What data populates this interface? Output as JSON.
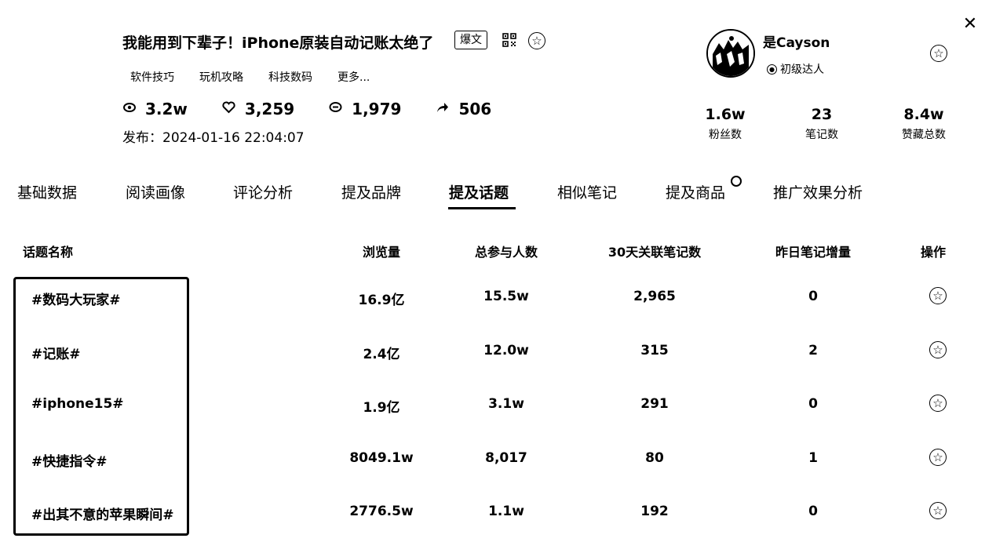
{
  "post": {
    "title": "我能用到下辈子！iPhone原装自动记账太绝了",
    "badge": "爆文",
    "tags": [
      "软件技巧",
      "玩机攻略",
      "科技数码",
      "更多..."
    ],
    "stats": {
      "views": "3.2w",
      "likes": "3,259",
      "comments": "1,979",
      "shares": "506"
    },
    "publish_label": "发布：",
    "publish_time": "2024-01-16 22:04:07"
  },
  "author": {
    "name": "是Cayson",
    "level": "初级达人",
    "metrics": [
      {
        "value": "1.6w",
        "label": "粉丝数"
      },
      {
        "value": "23",
        "label": "笔记数"
      },
      {
        "value": "8.4w",
        "label": "赞藏总数"
      }
    ]
  },
  "tabs": [
    "基础数据",
    "阅读画像",
    "评论分析",
    "提及品牌",
    "提及话题",
    "相似笔记",
    "提及商品",
    "推广效果分析"
  ],
  "active_tab": "提及话题",
  "table": {
    "headers": [
      "话题名称",
      "浏览量",
      "总参与人数",
      "30天关联笔记数",
      "昨日笔记增量",
      "操作"
    ],
    "rows": [
      {
        "topic": "#数码大玩家#",
        "views": "16.9亿",
        "participants": "15.5w",
        "notes30": "2,965",
        "yesterday": "0"
      },
      {
        "topic": "#记账#",
        "views": "2.4亿",
        "participants": "12.0w",
        "notes30": "315",
        "yesterday": "2"
      },
      {
        "topic": "#iphone15#",
        "views": "1.9亿",
        "participants": "3.1w",
        "notes30": "291",
        "yesterday": "0"
      },
      {
        "topic": "#快捷指令#",
        "views": "8049.1w",
        "participants": "8,017",
        "notes30": "80",
        "yesterday": "1"
      },
      {
        "topic": "#出其不意的苹果瞬间#",
        "views": "2776.5w",
        "participants": "1.1w",
        "notes30": "192",
        "yesterday": "0"
      }
    ]
  },
  "icons": {
    "close": "close-icon",
    "qr": "qr-code-icon",
    "star": "star-icon",
    "views": "eye-icon",
    "likes": "heart-icon",
    "comments": "comment-icon",
    "shares": "share-icon"
  }
}
